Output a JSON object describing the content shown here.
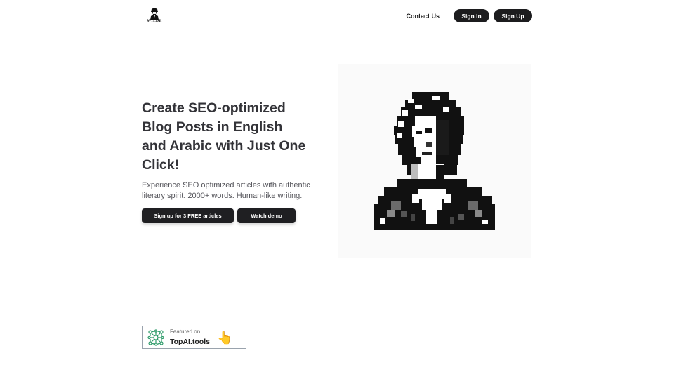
{
  "header": {
    "logo_text": "WILDE",
    "logo_icon": "wilde-portrait-logo-icon",
    "nav": {
      "contact": "Contact Us",
      "sign_in": "Sign In",
      "sign_up": "Sign Up"
    }
  },
  "hero": {
    "title": "Create SEO-optimized Blog Posts in English and Arabic with Just One Click!",
    "subtitle": "Experience SEO optimized articles with authentic literary spirit. 2000+ words. Human-like writing.",
    "primary_cta": "Sign up for 3 FREE articles",
    "secondary_cta": "Watch demo",
    "image": "pixel-art-portrait-oscar-wilde"
  },
  "badge": {
    "small": "Featured on",
    "big": "TopAI.tools",
    "icon": "network-icon",
    "hand_icon": "pointing-hand-icon",
    "hand_glyph": "👆"
  },
  "colors": {
    "primary_button": "#1f1f22",
    "text_dark": "#333338",
    "text_muted": "#55555b",
    "badge_green": "#2e9b6a"
  }
}
